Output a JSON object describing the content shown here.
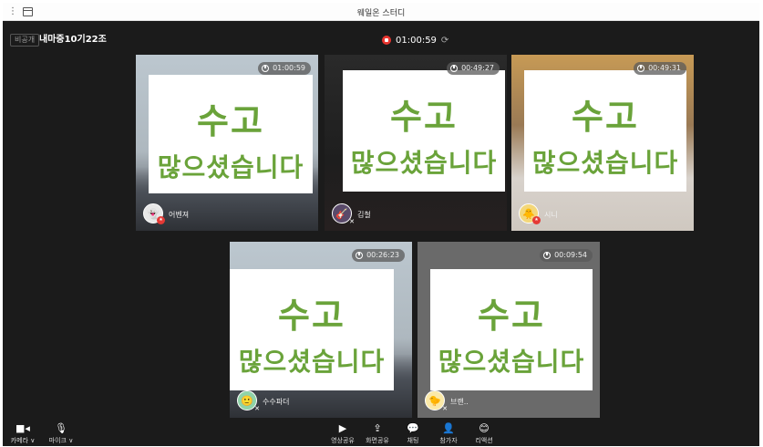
{
  "app": {
    "window_title": "웨일온 스터디",
    "menu_icon": "kebab-menu-icon",
    "window_icon": "window-icon"
  },
  "infobar": {
    "private_label": "비공개",
    "room_name": "내마중10기22조",
    "timer": "01:00:59",
    "rec_color": "#e8352f"
  },
  "card": {
    "line1": "수고",
    "line2": "많으셨습니다",
    "color": "#6aa33a"
  },
  "participants": [
    {
      "name": "어벤져",
      "time": "01:00:59",
      "avatar": "ghost-avatar",
      "host": true
    },
    {
      "name": "김철",
      "time": "00:49:27",
      "avatar": "photo-avatar",
      "muted": true
    },
    {
      "name": "시니",
      "time": "00:49:31",
      "avatar": "emoji-avatar",
      "host": true
    },
    {
      "name": "수수파더",
      "time": "00:26:23",
      "avatar": "green-avatar",
      "muted": true
    },
    {
      "name": "브랜..",
      "time": "00:09:54",
      "avatar": "chick-avatar",
      "muted": true
    }
  ],
  "toolbar": {
    "left": [
      {
        "label": "카메라 ∨",
        "icon": "camera-icon"
      },
      {
        "label": "마이크 ∨",
        "icon": "microphone-icon"
      }
    ],
    "center": [
      {
        "label": "영상공유",
        "icon": "play-icon"
      },
      {
        "label": "화면공유",
        "icon": "screen-share-icon"
      },
      {
        "label": "채팅",
        "icon": "chat-icon"
      },
      {
        "label": "참가자",
        "icon": "person-icon"
      },
      {
        "label": "리액션",
        "icon": "smile-icon"
      }
    ]
  }
}
